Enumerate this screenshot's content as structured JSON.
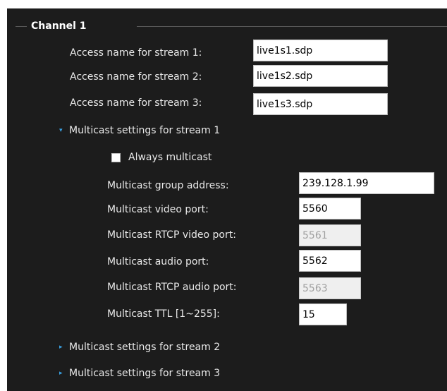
{
  "channel": {
    "title": "Channel 1",
    "access_names": [
      {
        "label": "Access name for stream 1:",
        "value": "live1s1.sdp"
      },
      {
        "label": "Access name for stream 2:",
        "value": "live1s2.sdp"
      },
      {
        "label": "Access name for stream 3:",
        "value": "live1s3.sdp"
      }
    ],
    "multicast_stream1": {
      "toggle_label": "Multicast settings for stream 1",
      "expanded": true,
      "always_multicast": {
        "label": "Always multicast",
        "checked": false
      },
      "group_address": {
        "label": "Multicast group address:",
        "value": "239.128.1.99"
      },
      "video_port": {
        "label": "Multicast video port:",
        "value": "5560"
      },
      "rtcp_video_port": {
        "label": "Multicast RTCP video port:",
        "value": "5561",
        "disabled": true
      },
      "audio_port": {
        "label": "Multicast audio port:",
        "value": "5562"
      },
      "rtcp_audio_port": {
        "label": "Multicast RTCP audio port:",
        "value": "5563",
        "disabled": true
      },
      "ttl": {
        "label": "Multicast TTL [1~255]:",
        "value": "15"
      }
    },
    "multicast_stream2": {
      "toggle_label": "Multicast settings for stream 2",
      "expanded": false
    },
    "multicast_stream3": {
      "toggle_label": "Multicast settings for stream 3",
      "expanded": false
    }
  },
  "colors": {
    "panel_background": "#1c1c1c",
    "text": "#e8e8e8",
    "chevron_accent": "#3aa0e0",
    "disabled_input_background": "#efefef"
  },
  "icons": {
    "expanded": "chevron-down-icon",
    "collapsed": "chevron-right-icon"
  }
}
